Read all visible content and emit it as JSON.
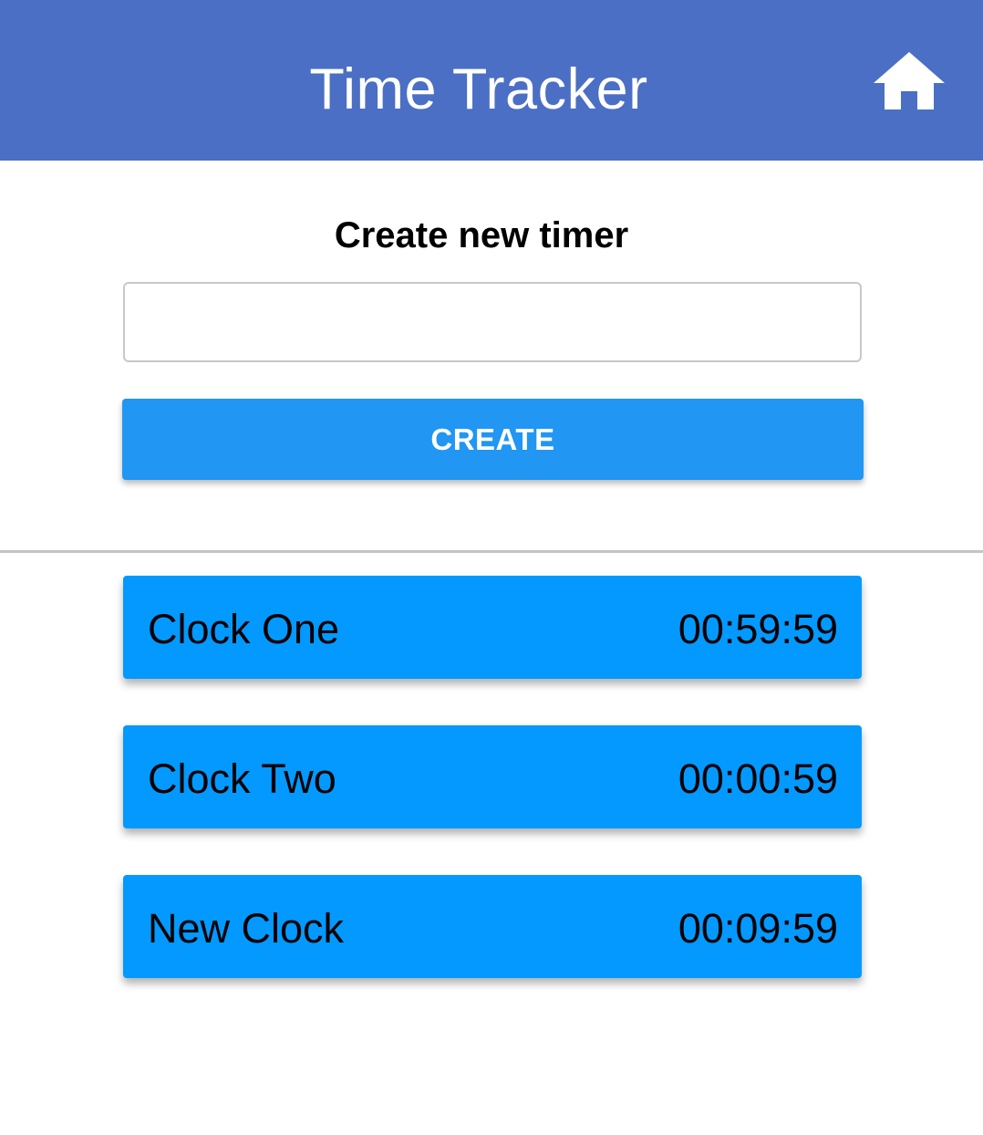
{
  "app_bar": {
    "title": "Time Tracker",
    "home_icon": "home-icon",
    "background_color": "#4a6fc4"
  },
  "create_section": {
    "heading": "Create new timer",
    "input_value": "",
    "input_placeholder": "",
    "button_label": "CREATE",
    "button_color": "#2196f3"
  },
  "timers": [
    {
      "name": "Clock One",
      "time": "00:59:59"
    },
    {
      "name": "Clock Two",
      "time": "00:00:59"
    },
    {
      "name": "New Clock",
      "time": "00:09:59"
    }
  ],
  "timer_card_color": "#0399fe"
}
